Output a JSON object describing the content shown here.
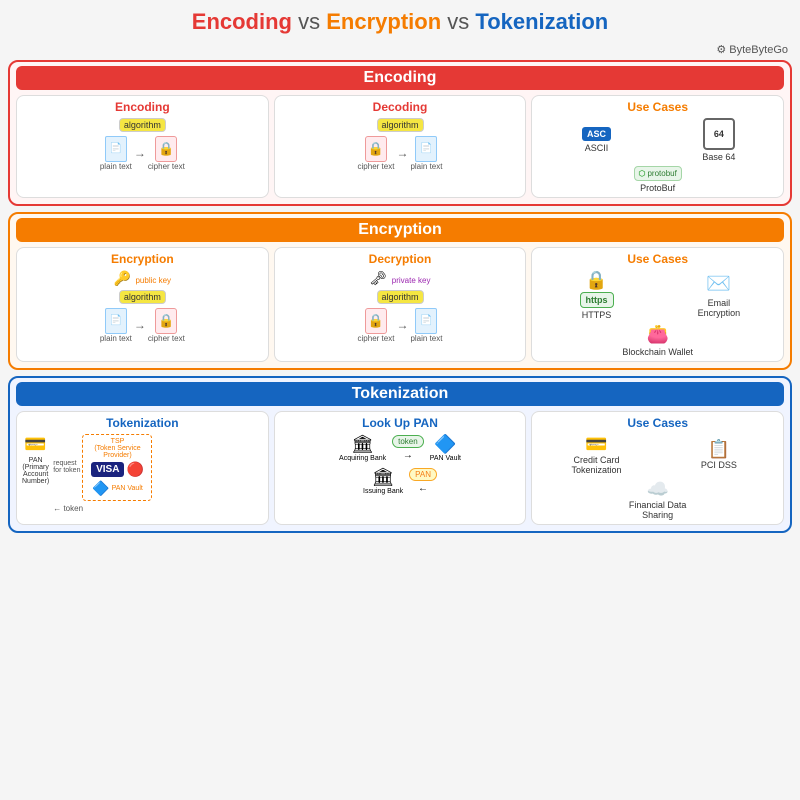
{
  "title": {
    "encoding": "Encoding",
    "vs1": "vs",
    "encryption": "Encryption",
    "vs2": "vs",
    "tokenization": "Tokenization"
  },
  "brand": "⚙ ByteByteGo",
  "sections": {
    "encoding": {
      "header": "Encoding",
      "sub": {
        "encoding": {
          "title": "Encoding",
          "plain": "plain text",
          "cipher": "cipher text",
          "algo": "algorithm"
        },
        "decoding": {
          "title": "Decoding",
          "plain": "plain text",
          "cipher": "cipher text",
          "algo": "algorithm"
        },
        "usecases": {
          "title": "Use Cases",
          "items": [
            "ASCII",
            "Base 64",
            "ProtoBuf"
          ]
        }
      }
    },
    "encryption": {
      "header": "Encryption",
      "sub": {
        "encryption": {
          "title": "Encryption",
          "plain": "plain text",
          "cipher": "cipher text",
          "algo": "algorithm",
          "key": "public key"
        },
        "decryption": {
          "title": "Decryption",
          "plain": "plain text",
          "cipher": "cipher text",
          "algo": "algorithm",
          "key": "private key"
        },
        "usecases": {
          "title": "Use Cases",
          "items": [
            "HTTPS",
            "Email Encryption",
            "Blockchain Wallet"
          ]
        }
      }
    },
    "tokenization": {
      "header": "Tokenization",
      "sub": {
        "tokenization": {
          "title": "Tokenization",
          "pan_label": "PAN (Primary Account Number)",
          "token_label": "token",
          "request_label": "request for token",
          "tsp_label": "TSP (Token Service Provider)",
          "pan_vault_label": "PAN Vault"
        },
        "lookup": {
          "title": "Look Up PAN",
          "token": "token",
          "pan": "PAN",
          "acquiring": "Acquiring Bank",
          "issuing": "Issuing Bank",
          "vault": "PAN Vault"
        },
        "usecases": {
          "title": "Use Cases",
          "items": [
            "Credit Card Tokenization",
            "PCI DSS",
            "Financial Data Sharing"
          ]
        }
      }
    }
  }
}
